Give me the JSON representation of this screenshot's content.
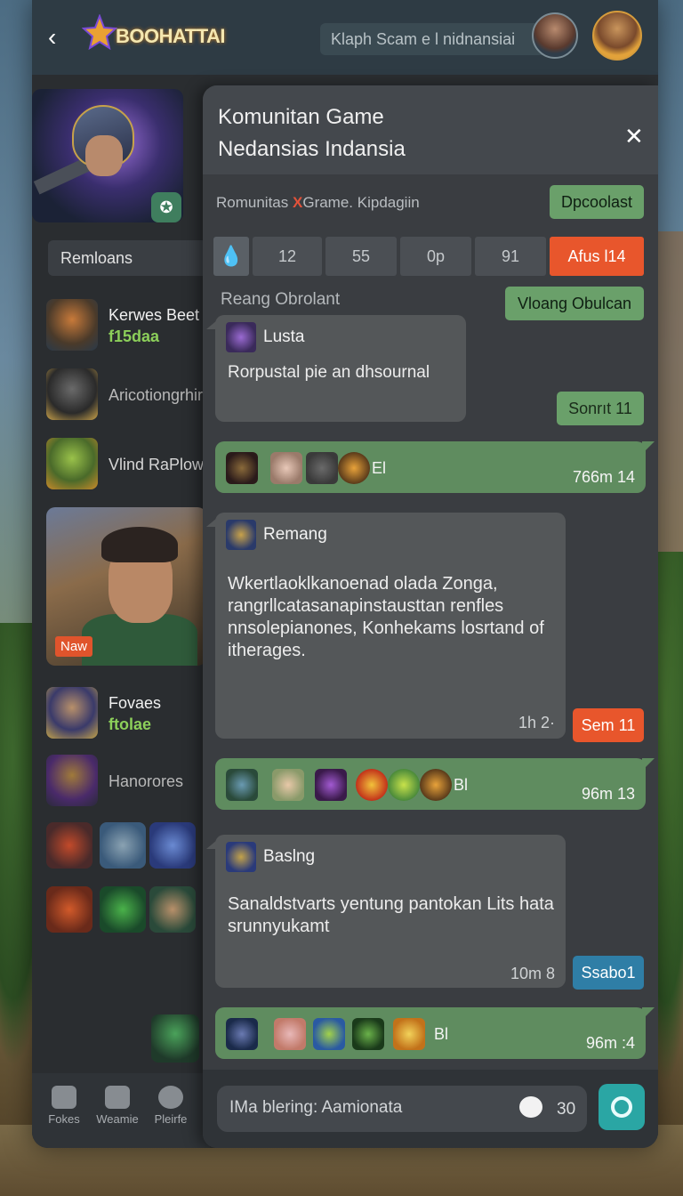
{
  "header": {
    "logo_text": "BOOHATTAI",
    "search_text": "Klaph Scam e l nidnansiai"
  },
  "sidebar": {
    "search_label": "Remloans",
    "items": [
      {
        "name": "Kerwes Beet",
        "sub": "f15daa"
      },
      {
        "name": "Aricotiongrhir"
      },
      {
        "name": "Vlind RaPlow"
      },
      {
        "name": "Fovaes",
        "sub": "ftolae"
      },
      {
        "name": "Hanorores"
      }
    ],
    "promo_tag": "Naw",
    "nav": [
      {
        "label": "Fokes"
      },
      {
        "label": "Weamie"
      },
      {
        "label": "Pleirfe"
      }
    ]
  },
  "panel": {
    "title_line1": "Komunitan Game",
    "title_line2": "Nedansias Indansia",
    "crumb_a": "Romunitas",
    "crumb_x": "X",
    "crumb_b": "Grame. Kipdagiin",
    "top_button": "Dpcoolast",
    "tabs": [
      "12",
      "55",
      "0p",
      "91",
      "Afus l14"
    ],
    "section_label": "Reang Obrolant",
    "section_button": "Vloang Obulcan",
    "messages": [
      {
        "name": "Lusta",
        "text": "Rorpustal pie an dhsournal",
        "pill": "Sonrıt 11"
      },
      {
        "name": "Remang",
        "text": "Wkertlaoklkanoenad olada Zonga, rangrllcatasanapinstausttan renfles nnsolepianones, Konhekams losrtand of itherages.",
        "time": "1h 2·",
        "pill": "Sem 11"
      },
      {
        "name": "Baslng",
        "text": "Sanaldstvarts yentung pantokan Lits hata srunnyukamt",
        "time": "10m 8",
        "pill": "Ssabo1"
      }
    ],
    "reactions": [
      {
        "label": "El",
        "time": "766m 14"
      },
      {
        "label": "Bl",
        "time": "96m 13"
      },
      {
        "label": "Bl",
        "time": "96m :4"
      }
    ],
    "composer_placeholder": "IMa blering: Aamionata",
    "composer_count": "30"
  }
}
